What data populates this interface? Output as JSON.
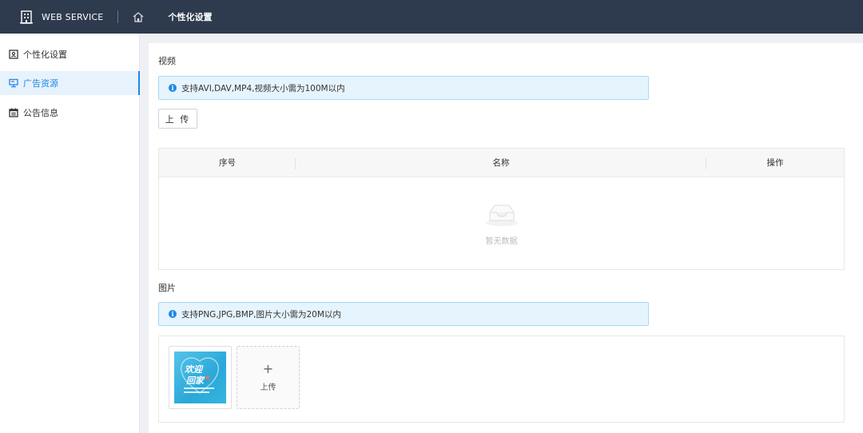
{
  "header": {
    "brand": "WEB SERVICE",
    "title": "个性化设置"
  },
  "sidebar": {
    "items": [
      {
        "label": "个性化设置",
        "icon": "id-card-icon",
        "active": false
      },
      {
        "label": "广告资源",
        "icon": "monitor-icon",
        "active": true
      },
      {
        "label": "公告信息",
        "icon": "calendar-icon",
        "active": false
      }
    ]
  },
  "video": {
    "title": "视频",
    "alert": "支持AVI,DAV,MP4,视频大小需为100M以内",
    "upload_button": "上 传",
    "table": {
      "columns": [
        "序号",
        "名称",
        "操作"
      ],
      "empty_text": "暂无数据"
    }
  },
  "image": {
    "title": "图片",
    "alert": "支持PNG,JPG,BMP,图片大小需为20M以内",
    "thumb_text_1": "欢迎",
    "thumb_text_2": "回家",
    "uploader_plus": "+",
    "uploader_label": "上传"
  },
  "colors": {
    "header_bg": "#2e3a4d",
    "accent": "#1e88e5",
    "alert_bg": "#e6f4fd"
  }
}
